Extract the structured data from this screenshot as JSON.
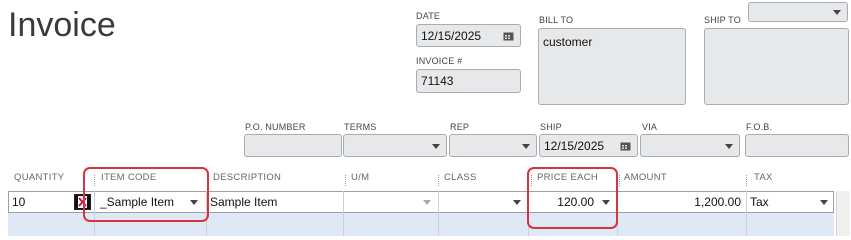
{
  "title": "Invoice",
  "date": {
    "label": "DATE",
    "value": "12/15/2025"
  },
  "invoice_no": {
    "label": "INVOICE #",
    "value": "71143"
  },
  "bill_to": {
    "label": "BILL TO",
    "value": "customer"
  },
  "ship_to": {
    "label": "SHIP TO",
    "value": ""
  },
  "po_number": {
    "label": "P.O. NUMBER",
    "value": ""
  },
  "terms": {
    "label": "TERMS",
    "value": ""
  },
  "rep": {
    "label": "REP",
    "value": ""
  },
  "ship": {
    "label": "SHIP",
    "value": "12/15/2025"
  },
  "via": {
    "label": "VIA",
    "value": ""
  },
  "fob": {
    "label": "F.O.B.",
    "value": ""
  },
  "columns": {
    "quantity": "QUANTITY",
    "item_code": "ITEM CODE",
    "description": "DESCRIPTION",
    "um": "U/M",
    "class": "CLASS",
    "price_each": "PRICE EACH",
    "amount": "AMOUNT",
    "tax": "TAX"
  },
  "row": {
    "quantity": "10",
    "item_code": "_Sample Item",
    "description": "Sample Item",
    "um": "",
    "class": "",
    "price_each": "120.00",
    "amount": "1,200.00",
    "tax": "Tax"
  },
  "colors": {
    "highlight": "#d9343b",
    "field_bg": "#e7e8e9",
    "empty_row": "#dfe9f6"
  },
  "icons": [
    "calendar-icon",
    "dropdown-caret-icon",
    "item-lookup-icon"
  ]
}
